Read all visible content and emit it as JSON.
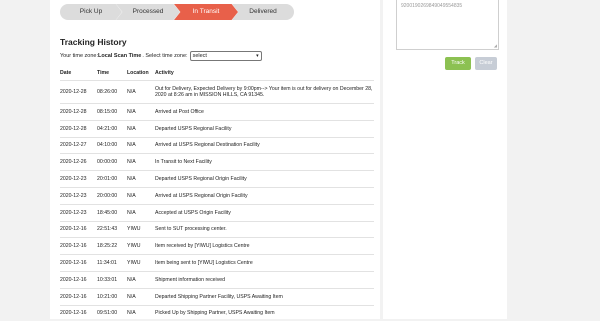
{
  "progress": {
    "steps": [
      "Pick Up",
      "Processed",
      "In Transit",
      "Delivered"
    ],
    "active_index": 2
  },
  "tracking_history": {
    "title": "Tracking History",
    "tz_prefix": "Your time zone: ",
    "tz_value": "Local Scan Time",
    "tz_select_label": ". Select time zone:",
    "tz_select_value": "select",
    "columns": [
      "Date",
      "Time",
      "Location",
      "Activity"
    ],
    "rows": [
      {
        "date": "2020-12-28",
        "time": "08:26:00",
        "location": "N/A",
        "activity": "Out for Delivery, Expected Delivery by 9:00pm--> Your item is out for delivery on December 28, 2020 at 8:26 am in MISSION HILLS, CA 91345."
      },
      {
        "date": "2020-12-28",
        "time": "08:15:00",
        "location": "N/A",
        "activity": "Arrived at Post Office"
      },
      {
        "date": "2020-12-28",
        "time": "04:21:00",
        "location": "N/A",
        "activity": "Departed USPS Regional Facility"
      },
      {
        "date": "2020-12-27",
        "time": "04:10:00",
        "location": "N/A",
        "activity": "Arrived at USPS Regional Destination Facility"
      },
      {
        "date": "2020-12-26",
        "time": "00:00:00",
        "location": "N/A",
        "activity": "In Transit to Next Facility"
      },
      {
        "date": "2020-12-23",
        "time": "20:01:00",
        "location": "N/A",
        "activity": "Departed USPS Regional Origin Facility"
      },
      {
        "date": "2020-12-23",
        "time": "20:00:00",
        "location": "N/A",
        "activity": "Arrived at USPS Regional Origin Facility"
      },
      {
        "date": "2020-12-23",
        "time": "18:45:00",
        "location": "N/A",
        "activity": "Accepted at USPS Origin Facility"
      },
      {
        "date": "2020-12-16",
        "time": "22:51:43",
        "location": "YIWU",
        "activity": "Sent to SUT processing center."
      },
      {
        "date": "2020-12-16",
        "time": "18:25:22",
        "location": "YIWU",
        "activity": "Item received by [YIWU] Logistics Centre"
      },
      {
        "date": "2020-12-16",
        "time": "11:34:01",
        "location": "YIWU",
        "activity": "Item being sent to [YIWU] Logistics Centre"
      },
      {
        "date": "2020-12-16",
        "time": "10:33:01",
        "location": "N/A",
        "activity": "Shipment information received"
      },
      {
        "date": "2020-12-16",
        "time": "10:21:00",
        "location": "N/A",
        "activity": "Departed Shipping Partner Facility, USPS Awaiting Item"
      },
      {
        "date": "2020-12-16",
        "time": "09:51:00",
        "location": "N/A",
        "activity": "Picked Up by Shipping Partner, USPS Awaiting Item"
      }
    ]
  },
  "sidebar": {
    "tracking_number": "9200190269849049554835",
    "track_label": "Track",
    "clear_label": "Clear"
  }
}
